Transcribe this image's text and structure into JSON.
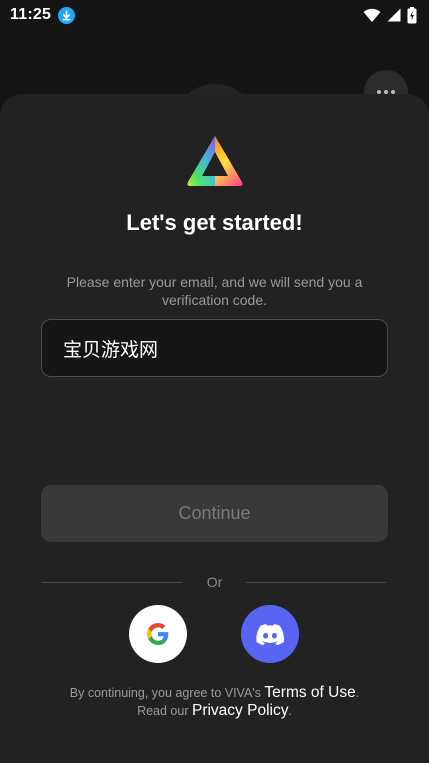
{
  "status_bar": {
    "time": "11:25"
  },
  "sheet": {
    "title": "Let's get started!",
    "subtitle": "Please enter your email, and we will send you a verification code.",
    "email_input": {
      "value": "宝贝游戏网",
      "placeholder": ""
    },
    "continue_label": "Continue",
    "divider_label": "Or",
    "social": {
      "google": "google-icon",
      "discord": "discord-icon"
    },
    "legal": {
      "prefix": "By continuing, you agree to VIVA's",
      "terms_link": "Terms of Use",
      "period1": ".",
      "read_prefix": "Read our",
      "privacy_link": "Privacy Policy",
      "period2": "."
    }
  },
  "colors": {
    "background": "#151515",
    "sheet": "#222222",
    "continue_disabled": "#393939",
    "discord": "#5865f2",
    "download_badge": "#1ea7fd"
  }
}
